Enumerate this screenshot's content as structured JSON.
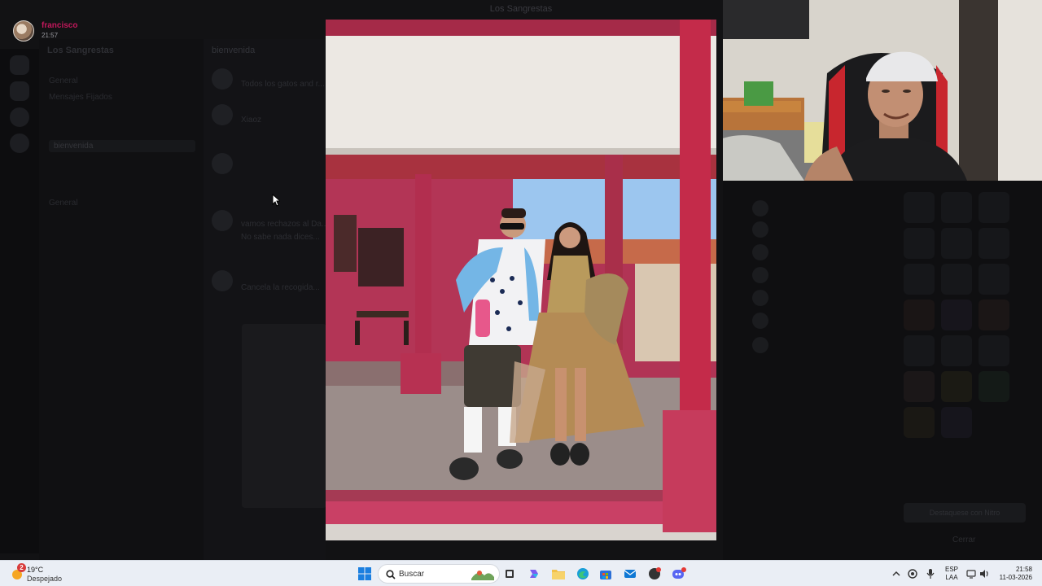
{
  "window": {
    "title": "Los Sangrestas"
  },
  "viewer": {
    "username": "francisco",
    "timestamp": "21:57"
  },
  "background_app": {
    "server_name": "Los Sangrestas",
    "channels": [
      "General",
      "Mensajes Fijados",
      "bienvenida",
      "General"
    ],
    "chat_header": "bienvenida",
    "messages": [
      "Todos los gatos and r...",
      "Xiaoz",
      "vamos rechazos al Da...",
      "No sabe nada dices...",
      "Cancela la recogida..."
    ],
    "highlight_button": "Destaquese con Nitro",
    "close_label": "Cerrar"
  },
  "taskbar": {
    "weather_badge": "2",
    "weather_temp": "19°C",
    "weather_desc": "Despejado",
    "search_placeholder": "Buscar",
    "lang_top": "ESP",
    "lang_bottom": "LAA",
    "time": "21:58",
    "date": "11-03-2026"
  },
  "colors": {
    "accent_user": "#c2185b",
    "taskbar_bg": "#eaeef5",
    "pillar_red": "#c63d5c"
  }
}
